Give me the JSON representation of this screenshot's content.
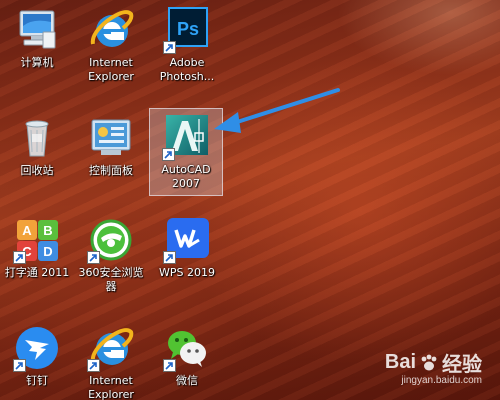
{
  "desktop": {
    "icons": [
      {
        "id": "computer",
        "label": "计算机",
        "icon": "computer-icon"
      },
      {
        "id": "ie",
        "label": "Internet Explorer",
        "icon": "internet-explorer-icon"
      },
      {
        "id": "photoshop",
        "label": "Adobe Photosh...",
        "icon": "photoshop-icon",
        "badge": "Ps"
      },
      {
        "id": "recycle",
        "label": "回收站",
        "icon": "recycle-bin-icon"
      },
      {
        "id": "control-panel",
        "label": "控制面板",
        "icon": "control-panel-icon"
      },
      {
        "id": "autocad",
        "label": "AutoCAD 2007",
        "icon": "autocad-icon",
        "badge": "A"
      },
      {
        "id": "typing",
        "label": "打字通 2011",
        "icon": "typing-tutor-icon",
        "badge": "A B C D"
      },
      {
        "id": "360",
        "label": "360安全浏览器",
        "icon": "360-browser-icon"
      },
      {
        "id": "wps",
        "label": "WPS 2019",
        "icon": "wps-icon",
        "badge": "W"
      },
      {
        "id": "dingtalk",
        "label": "钉钉",
        "icon": "dingtalk-icon"
      },
      {
        "id": "ie2",
        "label": "Internet Explorer",
        "icon": "internet-explorer-icon"
      },
      {
        "id": "wechat",
        "label": "微信",
        "icon": "wechat-icon"
      }
    ],
    "selected": "autocad"
  },
  "watermark": {
    "brand": "Bai",
    "brand2": "经验",
    "url": "jingyan.baidu.com"
  },
  "colors": {
    "arrow": "#2f8ee6",
    "selection": "#cdcdd7"
  }
}
